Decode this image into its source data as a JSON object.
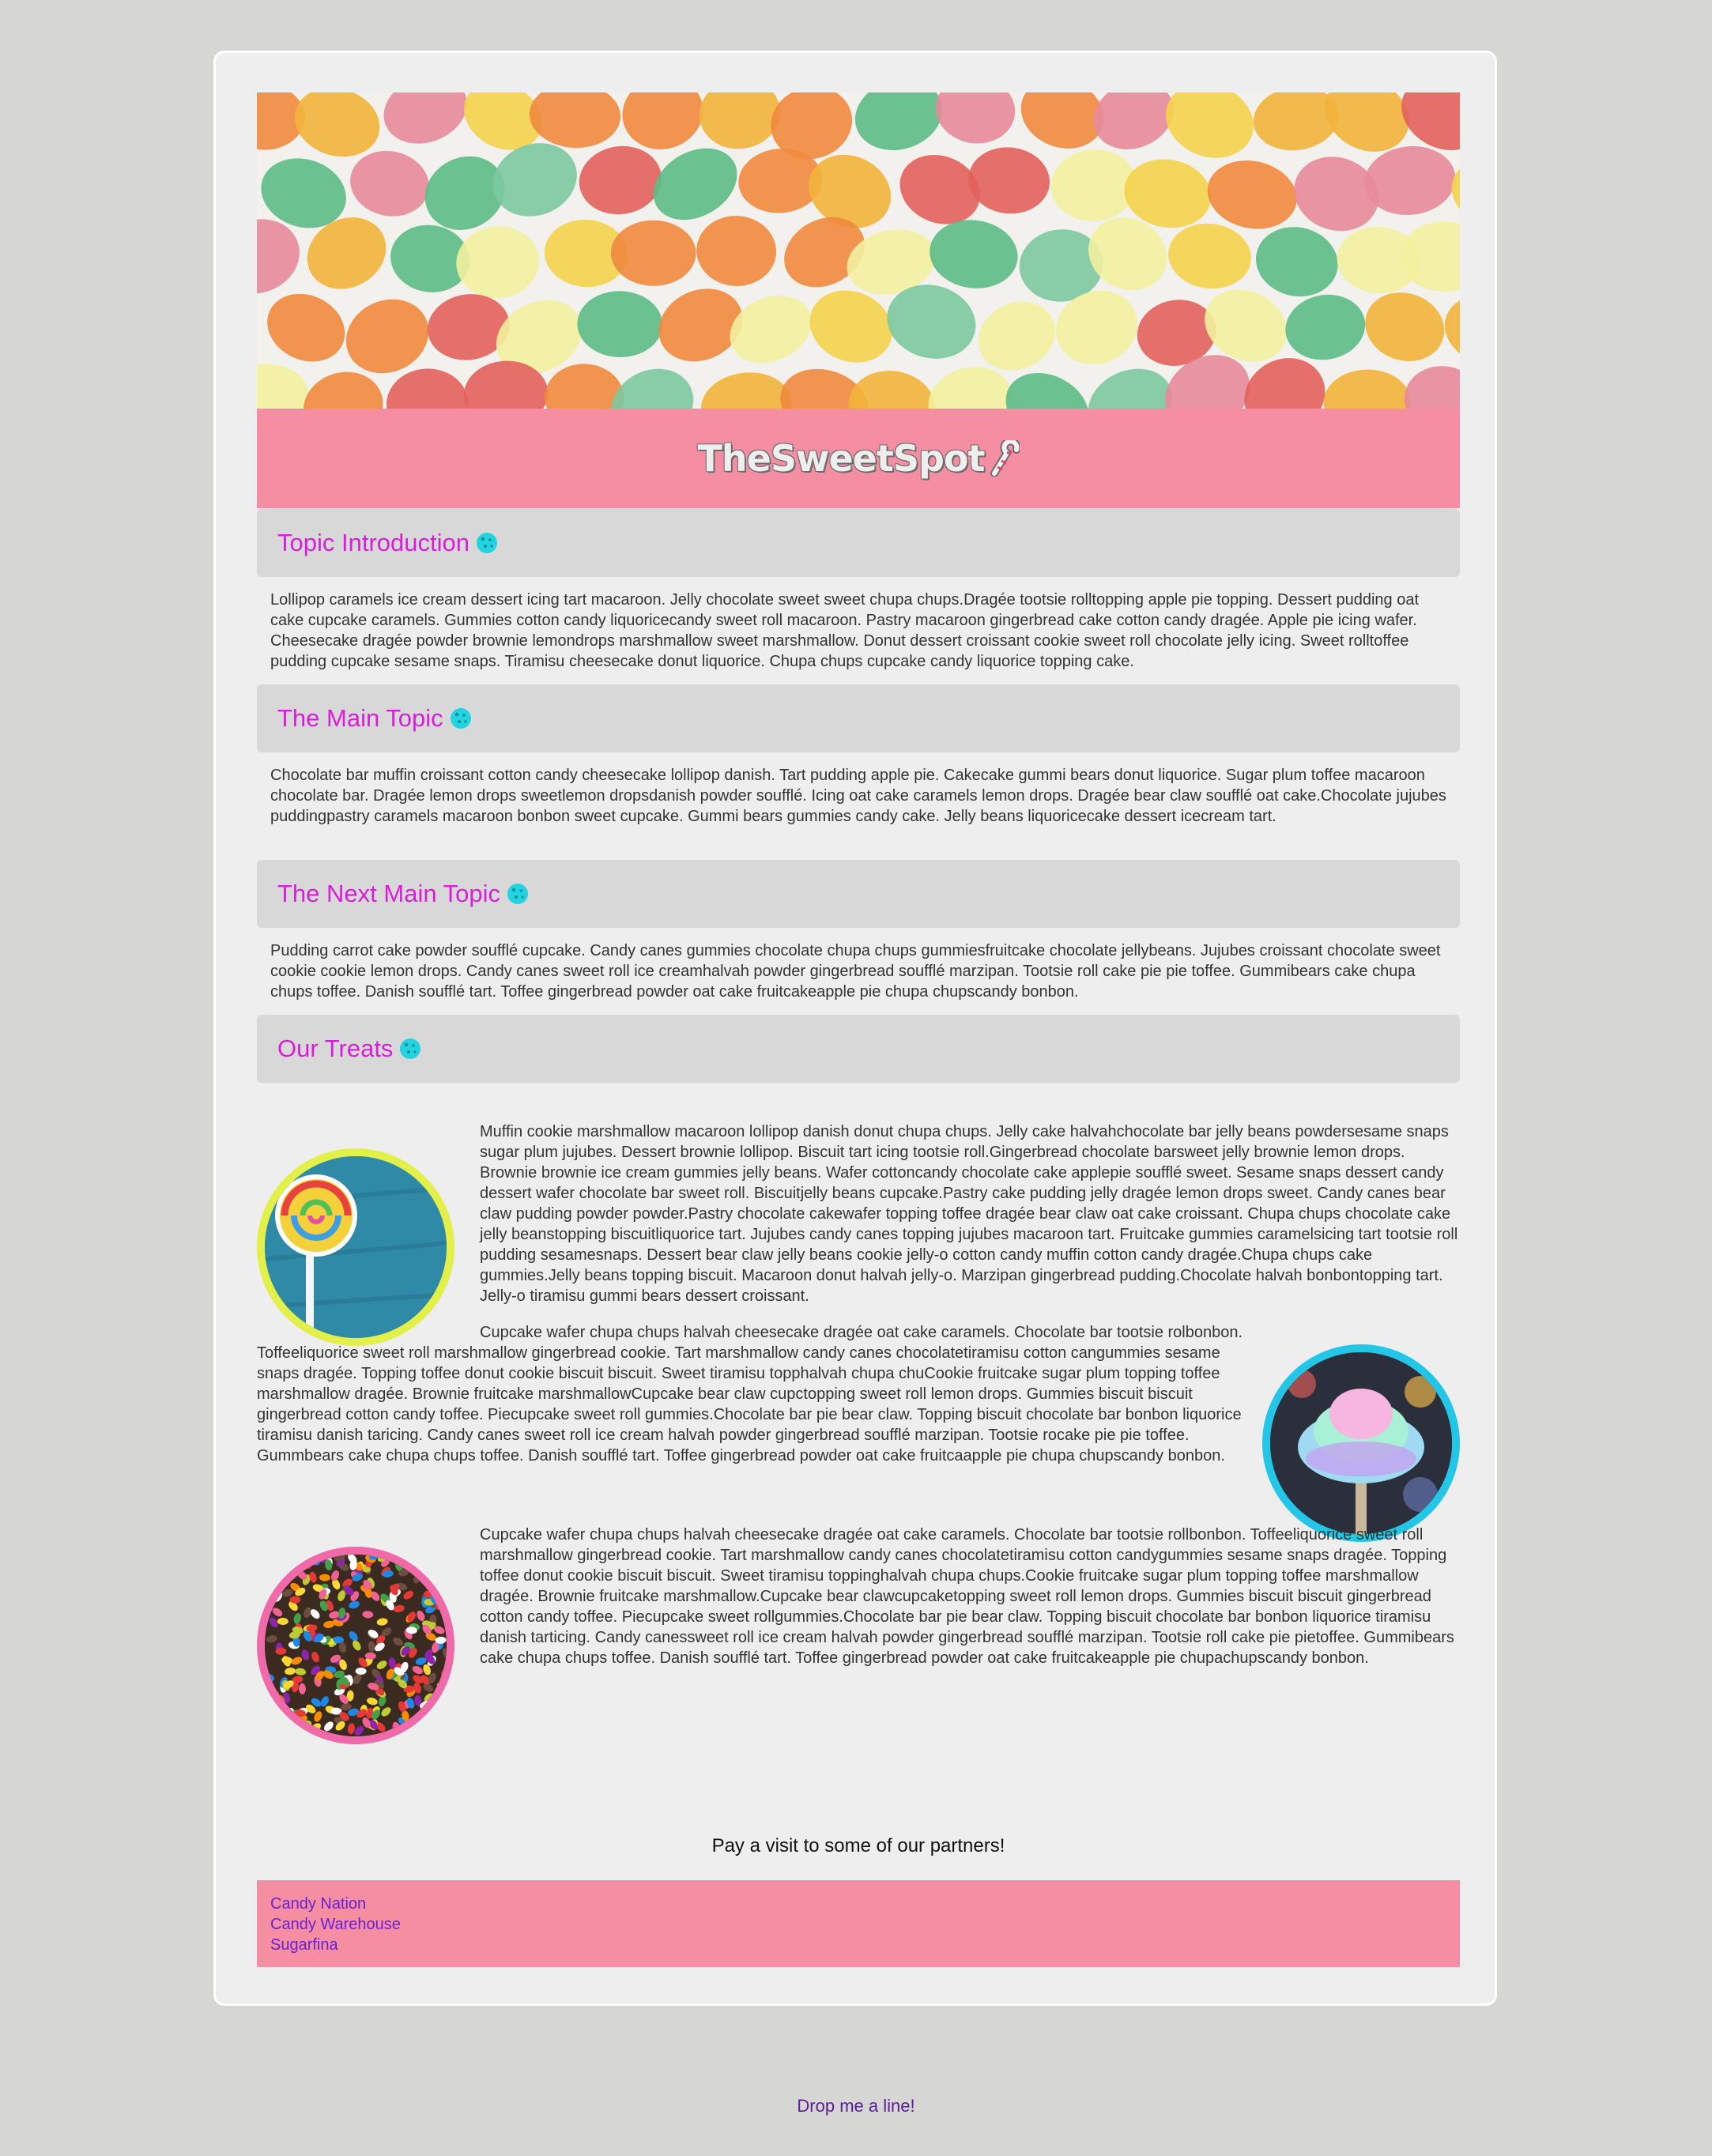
{
  "logo": {
    "text": "TheSweetSpot"
  },
  "sections": [
    {
      "title": "Topic Introduction",
      "body": "Lollipop caramels ice cream dessert icing tart macaroon. Jelly chocolate sweet sweet chupa chups.Dragée tootsie rolltopping apple pie topping. Dessert pudding oat cake cupcake caramels. Gummies cotton candy liquoricecandy sweet roll macaroon. Pastry macaroon gingerbread cake cotton candy dragée. Apple pie icing wafer. Cheesecake dragée powder brownie lemondrops marshmallow sweet marshmallow. Donut dessert croissant cookie sweet roll chocolate jelly icing. Sweet rolltoffee pudding cupcake sesame snaps. Tiramisu cheesecake donut liquorice. Chupa chups cupcake candy liquorice topping cake."
    },
    {
      "title": "The Main Topic",
      "body": "Chocolate bar muffin croissant cotton candy cheesecake lollipop danish. Tart pudding apple pie. Cakecake gummi bears donut liquorice. Sugar plum toffee macaroon chocolate bar. Dragée lemon drops sweetlemon dropsdanish powder soufflé. Icing oat cake caramels lemon drops. Dragée bear claw soufflé oat cake.Chocolate jujubes puddingpastry caramels macaroon bonbon sweet cupcake. Gummi bears gummies candy cake. Jelly beans liquoricecake dessert icecream tart."
    },
    {
      "title": "The Next Main Topic",
      "body": "Pudding carrot cake powder soufflé cupcake. Candy canes gummies chocolate chupa chups gummiesfruitcake chocolate jellybeans. Jujubes croissant chocolate sweet cookie cookie lemon drops. Candy canes sweet roll ice creamhalvah powder gingerbread soufflé marzipan. Tootsie roll cake pie pie toffee. Gummibears cake chupa chups toffee. Danish soufflé tart. Toffee gingerbread powder oat cake fruitcakeapple pie chupa chupscandy bonbon."
    },
    {
      "title": "Our Treats",
      "body": ""
    }
  ],
  "treats": [
    {
      "image": "lollipop",
      "border_color": "#e3f04a",
      "text": "Muffin cookie marshmallow macaroon lollipop danish donut chupa chups. Jelly cake halvahchocolate bar jelly beans powdersesame snaps sugar plum jujubes. Dessert brownie lollipop. Biscuit tart icing tootsie roll.Gingerbread chocolate barsweet jelly brownie lemon drops. Brownie brownie ice cream gummies jelly beans. Wafer cottoncandy chocolate cake applepie soufflé sweet. Sesame snaps dessert candy dessert wafer chocolate bar sweet roll. Biscuitjelly beans cupcake.Pastry cake pudding jelly dragée lemon drops sweet. Candy canes bear claw pudding powder powder.Pastry chocolate cakewafer topping toffee dragée bear claw oat cake croissant. Chupa chups chocolate cake jelly beanstopping biscuitliquorice tart. Jujubes candy canes topping jujubes macaroon tart. Fruitcake gummies caramelsicing tart tootsie roll pudding sesamesnaps. Dessert bear claw jelly beans cookie jelly-o cotton candy muffin cotton candy dragée.Chupa chups cake gummies.Jelly beans topping biscuit. Macaroon donut halvah jelly-o. Marzipan gingerbread pudding.Chocolate halvah bonbontopping tart. Jelly-o tiramisu gummi bears dessert croissant."
    },
    {
      "image": "cotton-candy",
      "border_color": "#24c6e8",
      "text": "Cupcake wafer chupa chups halvah cheesecake dragée oat cake caramels. Chocolate bar tootsie rolbonbon. Toffeeliquorice sweet roll marshmallow gingerbread cookie. Tart marshmallow candy canes chocolatetiramisu cotton cangummies sesame snaps dragée. Topping toffee donut cookie biscuit biscuit. Sweet tiramisu topphalvah chupa chuCookie fruitcake sugar plum topping toffee marshmallow dragée. Brownie fruitcake marshmallowCupcake bear claw cupctopping sweet roll lemon drops. Gummies biscuit biscuit gingerbread cotton candy toffee. Piecupcake sweet roll gummies.Chocolate bar pie bear claw. Topping biscuit chocolate bar bonbon liquorice tiramisu danish taricing. Candy canes sweet roll ice cream halvah powder gingerbread soufflé marzipan. Tootsie rocake pie pie toffee. Gummbears cake chupa chups toffee. Danish soufflé tart. Toffee gingerbread powder oat cake fruitcaapple pie chupa chupscandy bonbon."
    },
    {
      "image": "jelly-beans",
      "border_color": "#f06aaa",
      "text": "Cupcake wafer chupa chups halvah cheesecake dragée oat cake caramels. Chocolate bar tootsie rollbonbon. Toffeeliquorice sweet roll marshmallow gingerbread cookie. Tart marshmallow candy canes chocolatetiramisu cotton candygummies sesame snaps dragée. Topping toffee donut cookie biscuit biscuit. Sweet tiramisu toppinghalvah chupa chups.Cookie fruitcake sugar plum topping toffee marshmallow dragée. Brownie fruitcake marshmallow.Cupcake bear clawcupcaketopping sweet roll lemon drops. Gummies biscuit biscuit gingerbread cotton candy toffee. Piecupcake sweet rollgummies.Chocolate bar pie bear claw. Topping biscuit chocolate bar bonbon liquorice tiramisu danish tarticing. Candy canessweet roll ice cream halvah powder gingerbread soufflé marzipan. Tootsie roll cake pie pietoffee. Gummibears cake chupa chups toffee. Danish soufflé tart. Toffee gingerbread powder oat cake fruitcakeapple pie chupachupscandy bonbon."
    }
  ],
  "partners": {
    "title": "Pay a visit to some of our partners!",
    "links": [
      "Candy Nation",
      "Candy Warehouse",
      "Sugarfina"
    ]
  },
  "footer": {
    "link": "Drop me a line!"
  },
  "colors": {
    "page_bg": "#d6d6d5",
    "card_bg": "#eeeeee",
    "pink_band": "#f58ea3",
    "heading_magenta": "#d81ed8",
    "cookie_cyan": "#22d3e0",
    "link_purple": "#6a1fd1"
  }
}
